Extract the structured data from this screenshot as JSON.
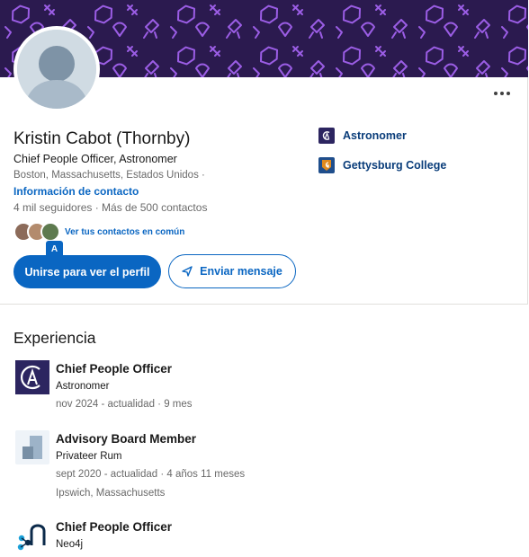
{
  "profile": {
    "name": "Kristin Cabot (Thornby)",
    "headline": "Chief People Officer, Astronomer",
    "location": "Boston, Massachusetts, Estados Unidos  ·",
    "contact_link": "Información de contacto",
    "stats": "4 mil seguidores  ·  Más de 500 contactos",
    "mutual_text": "Ver tus contactos en común",
    "translate_icon_label": "A"
  },
  "actions": {
    "join_label": "Unirse para ver el perfil",
    "message_label": "Enviar mensaje"
  },
  "organizations": [
    {
      "name": "Astronomer",
      "icon": "astronomer-logo",
      "color": "#2c2560"
    },
    {
      "name": "Gettysburg College",
      "icon": "gettysburg-college-logo",
      "color": "#1f4e8c"
    }
  ],
  "experience": {
    "title": "Experiencia",
    "items": [
      {
        "role": "Chief People Officer",
        "company": "Astronomer",
        "dates": "nov 2024 - actualidad  · 9 mes",
        "location": ""
      },
      {
        "role": "Advisory Board Member",
        "company": "Privateer Rum",
        "dates": "sept 2020 - actualidad  · 4 años 11 meses",
        "location": "Ipswich, Massachusetts"
      },
      {
        "role": "Chief People Officer",
        "company": "Neo4j",
        "dates": "",
        "location": ""
      }
    ]
  },
  "colors": {
    "accent": "#0a66c2",
    "banner": "#2b1a4f",
    "banner_pattern": "#9b5de5"
  }
}
